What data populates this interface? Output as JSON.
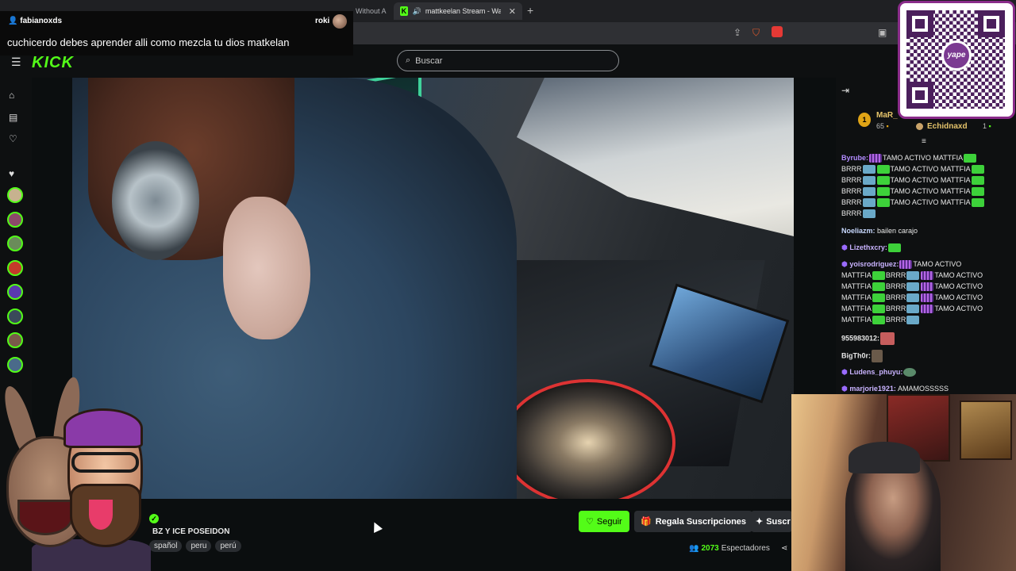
{
  "browser": {
    "tabs": [
      {
        "label": "Without A"
      },
      {
        "label": "mattkeelan Stream - Watch Li",
        "active": true
      }
    ]
  },
  "kick": {
    "logo": "KICK",
    "search_placeholder": "Buscar"
  },
  "stream": {
    "title": "BZ Y ICE POSEIDON",
    "tags": [
      "spañol",
      "peru",
      "perú"
    ],
    "follow_label": "Seguir",
    "gift_label": "Regala Suscripciones",
    "subscribe_label": "Suscr",
    "viewer_count": "2073",
    "viewer_label": "Espectadores"
  },
  "chat": {
    "pinned": [
      {
        "rank": "1",
        "name": "MaR_",
        "count": "65"
      },
      {
        "name": "Echidnaxd",
        "count": "1"
      }
    ],
    "lines": {
      "l1_user": "Byrube:",
      "l1_text": "TAMO ACTIVO MATTFIA",
      "l2_a": "BRRR",
      "l2_text": "TAMO ACTIVO MATTFIA",
      "l3_a": "BRRR",
      "l3_text": "TAMO ACTIVO MATTFIA",
      "l4_a": "BRRR",
      "l4_text": "TAMO ACTIVO MATTFIA",
      "l5_a": "BRRR",
      "l5_text": "TAMO ACTIVO MATTFIA",
      "l6_a": "BRRR",
      "l7_user": "Noeliazm:",
      "l7_text": "bailen carajo",
      "l8_user": "Lizethxcry:",
      "l9_user": "yoisrodriguez:",
      "l9_text": "TAMO ACTIVO",
      "l10_a": "MATTFIA",
      "l10_b": "BRRR",
      "l10_c": "TAMO ACTIVO",
      "l11_a": "MATTFIA",
      "l11_b": "BRRR",
      "l11_c": "TAMO ACTIVO",
      "l12_a": "MATTFIA",
      "l12_b": "BRRR",
      "l12_c": "TAMO ACTIVO",
      "l13_a": "MATTFIA",
      "l13_b": "BRRR",
      "l13_c": "TAMO ACTIVO",
      "l14_a": "MATTFIA",
      "l14_b": "BRRR",
      "l15_user": "955983012:",
      "l16_user": "BigTh0r:",
      "l17_user": "Ludens_phuyu:",
      "l18_user": "marjorie1921:",
      "l18_text": "AMAMOSSSSS"
    }
  },
  "overlay": {
    "user": "fabianoxds",
    "reply_to": "roki",
    "message": "cuchicerdo debes aprender alli como mezcla tu dios matkelan",
    "qr_logo": "yape"
  },
  "colors": {
    "kick_green": "#53fc18",
    "background": "#0b0e0f",
    "panel": "#0e1011"
  }
}
